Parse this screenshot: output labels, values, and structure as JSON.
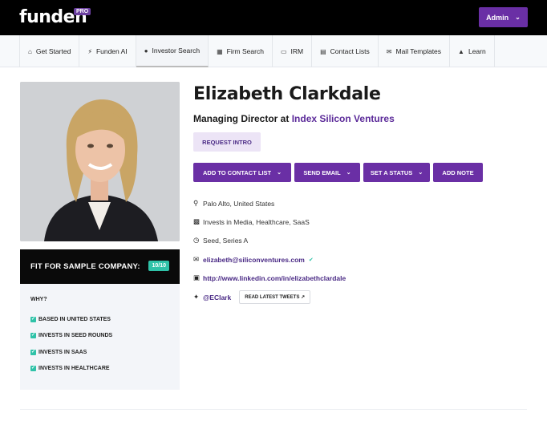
{
  "app": {
    "logo": "funden",
    "badge": "PRO"
  },
  "header": {
    "admin_label": "Admin"
  },
  "nav": {
    "tabs": [
      {
        "label": "Get Started",
        "icon": "home-icon"
      },
      {
        "label": "Funden AI",
        "icon": "bolt-icon"
      },
      {
        "label": "Investor Search",
        "icon": "user-icon"
      },
      {
        "label": "Firm Search",
        "icon": "building-icon"
      },
      {
        "label": "IRM",
        "icon": "card-icon"
      },
      {
        "label": "Contact Lists",
        "icon": "list-icon"
      },
      {
        "label": "Mail Templates",
        "icon": "mail-icon"
      },
      {
        "label": "Learn",
        "icon": "graduation-icon"
      }
    ],
    "active": "Investor Search"
  },
  "profile": {
    "name": "Elizabeth Clarkdale",
    "title_prefix": "Managing Director at",
    "firm": "Index Silicon Ventures",
    "request_intro": "REQUEST INTRO",
    "actions": {
      "add_to_list": "ADD TO CONTACT LIST",
      "send_email": "SEND EMAIL",
      "set_status": "SET A STATUS",
      "add_note": "ADD NOTE"
    },
    "location": "Palo Alto, United States",
    "invests_in": "Invests in Media, Healthcare, SaaS",
    "stages": "Seed, Series A",
    "email": "elizabeth@siliconventures.com",
    "linkedin": "http://www.linkedin.com/in/elizabethclardale",
    "twitter": "@EClark",
    "tweets_button": "READ LATEST TWEETS"
  },
  "fit": {
    "label": "FIT FOR SAMPLE COMPANY:",
    "score": "10/10",
    "why_title": "WHY?",
    "reasons": [
      "BASED IN UNITED STATES",
      "INVESTS IN SEED ROUNDS",
      "INVESTS IN SAAS",
      "INVESTS IN HEALTHCARE"
    ]
  },
  "colors": {
    "brand": "#6a2fa5",
    "accent": "#2fc2a8",
    "topbar": "#000000"
  }
}
